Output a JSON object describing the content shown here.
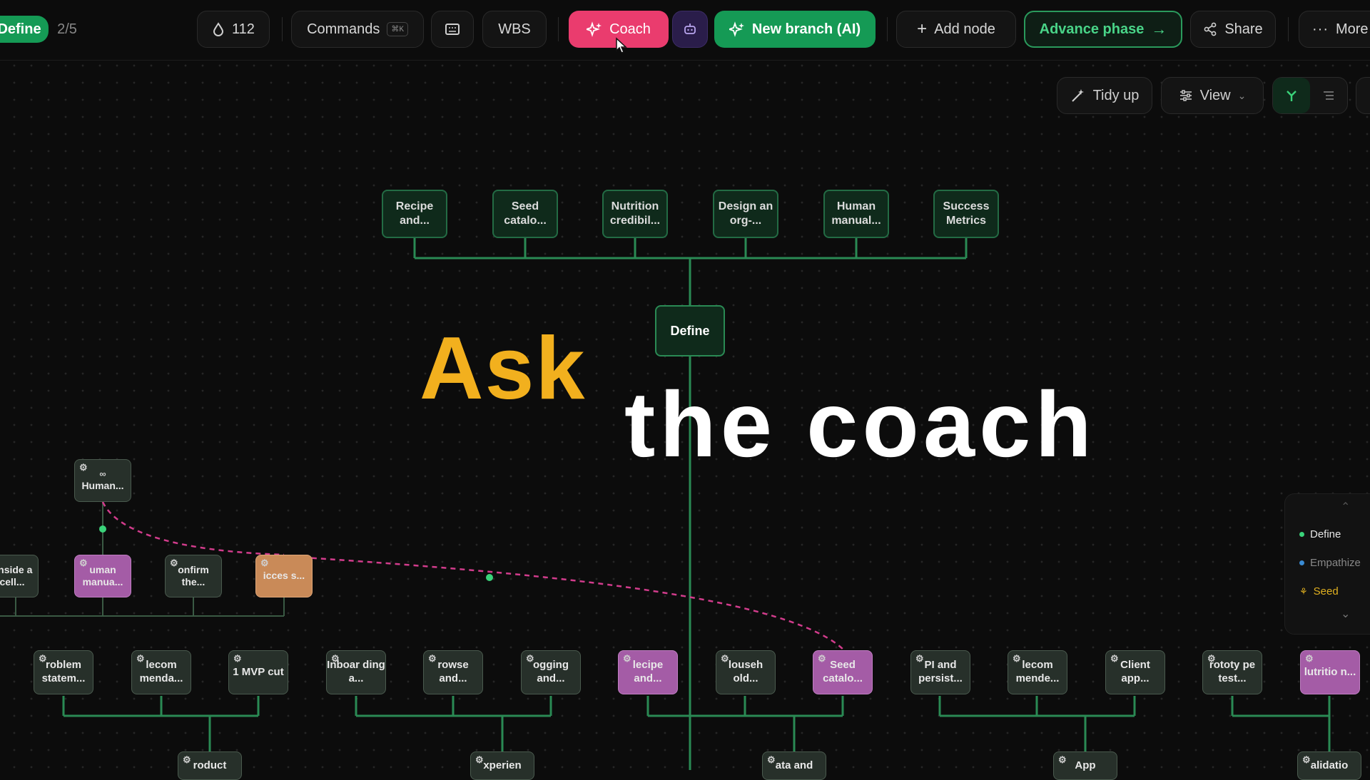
{
  "toolbar": {
    "phase_badge": "Define",
    "phase_progress": "2/5",
    "credits": "112",
    "commands_label": "Commands",
    "commands_shortcut": "⌘K",
    "wbs_label": "WBS",
    "coach_label": "Coach",
    "new_branch_label": "New branch (AI)",
    "add_node_label": "Add node",
    "advance_phase_label": "Advance phase",
    "share_label": "Share",
    "more_label": "More"
  },
  "view_toolbar": {
    "tidy_label": "Tidy up",
    "view_label": "View"
  },
  "overlay": {
    "ask": "Ask",
    "coach": "the coach"
  },
  "tree": {
    "root": "Define",
    "top_children": [
      "Recipe and...",
      "Seed catalo...",
      "Nutrition credibil...",
      "Design an org-...",
      "Human manual...",
      "Success Metrics"
    ],
    "left_cluster": {
      "parent": "Human...",
      "parent_icon": "∞",
      "children": [
        "onside a cell...",
        "uman manua...",
        "onfirm the...",
        "icces s..."
      ]
    },
    "bottom_row": [
      "roblem statem...",
      "lecom menda...",
      "1 MVP cut",
      "Inboar ding a...",
      "rowse and...",
      "ogging and...",
      "lecipe and...",
      "louseh old...",
      "Seed catalo...",
      "PI and persist...",
      "lecom mende...",
      "Client app...",
      "rototy pe test...",
      "lutritio n..."
    ],
    "bottom_parents": [
      "roduct",
      "xperien",
      "ata and",
      "App",
      "alidatio"
    ]
  },
  "phase_panel": {
    "items": [
      {
        "label": "Define",
        "color": "#3ad37a"
      },
      {
        "label": "Empathize",
        "color": "#3a8bd3"
      },
      {
        "label": "Seed",
        "color": "#e0b020"
      }
    ]
  },
  "colors": {
    "coach_button": "#ea3c6e",
    "new_branch_button": "#159a55",
    "advance_border": "#2a9a5c",
    "edge": "#2a8a54",
    "dependency": "#d23c8c",
    "ask_text": "#f2b01e"
  }
}
